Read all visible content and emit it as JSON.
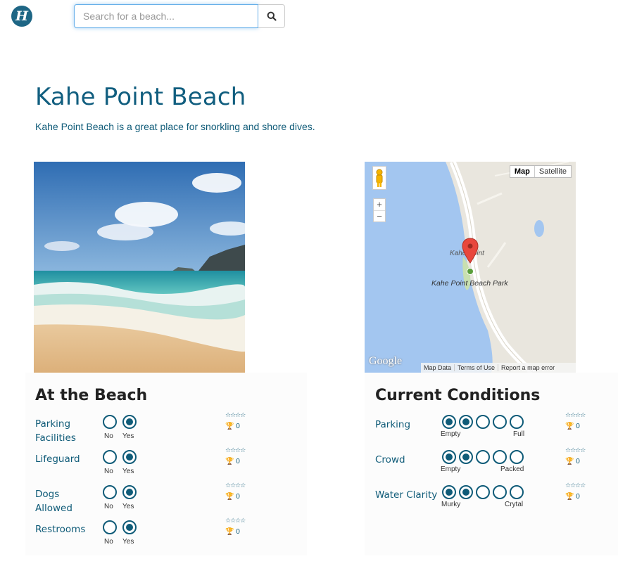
{
  "header": {
    "logo_letter": "H",
    "search_placeholder": "Search for a beach...",
    "search_icon": "search-icon"
  },
  "beach": {
    "name": "Kahe Point Beach",
    "description": "Kahe Point Beach is a great place for snorkling and shore dives."
  },
  "map": {
    "map_btn": "Map",
    "satellite_btn": "Satellite",
    "zoom_in": "+",
    "zoom_out": "−",
    "label_top": "Kahe Point",
    "label_park": "Kahe Point Beach Park",
    "google": "Google",
    "map_data": "Map Data",
    "terms": "Terms of Use",
    "report": "Report a map error",
    "colors": {
      "water": "#a3c6f0",
      "land": "#e9e6de",
      "road": "#ffffff",
      "pin": "#e8473d"
    }
  },
  "at_the_beach": {
    "title": "At the Beach",
    "rows": [
      {
        "label": "Parking Facilities",
        "opt_no": "No",
        "opt_yes": "Yes",
        "selected": "yes",
        "stars": "☆☆☆☆",
        "trophy": "🏆 0"
      },
      {
        "label": "Lifeguard",
        "opt_no": "No",
        "opt_yes": "Yes",
        "selected": "yes",
        "stars": "☆☆☆☆",
        "trophy": "🏆 0"
      },
      {
        "label": "Dogs Allowed",
        "opt_no": "No",
        "opt_yes": "Yes",
        "selected": "yes",
        "stars": "☆☆☆☆",
        "trophy": "🏆 0"
      },
      {
        "label": "Restrooms",
        "opt_no": "No",
        "opt_yes": "Yes",
        "selected": "yes",
        "stars": "☆☆☆☆",
        "trophy": "🏆 0"
      }
    ]
  },
  "current_conditions": {
    "title": "Current Conditions",
    "rows": [
      {
        "label": "Parking",
        "low": "Empty",
        "high": "Full",
        "level": 2,
        "stars": "☆☆☆☆",
        "trophy": "🏆 0"
      },
      {
        "label": "Crowd",
        "low": "Empty",
        "high": "Packed",
        "level": 2,
        "stars": "☆☆☆☆",
        "trophy": "🏆 0"
      },
      {
        "label": "Water Clarity",
        "low": "Murky",
        "high": "Crytal",
        "level": 2,
        "stars": "☆☆☆☆",
        "trophy": "🏆 0"
      }
    ]
  }
}
